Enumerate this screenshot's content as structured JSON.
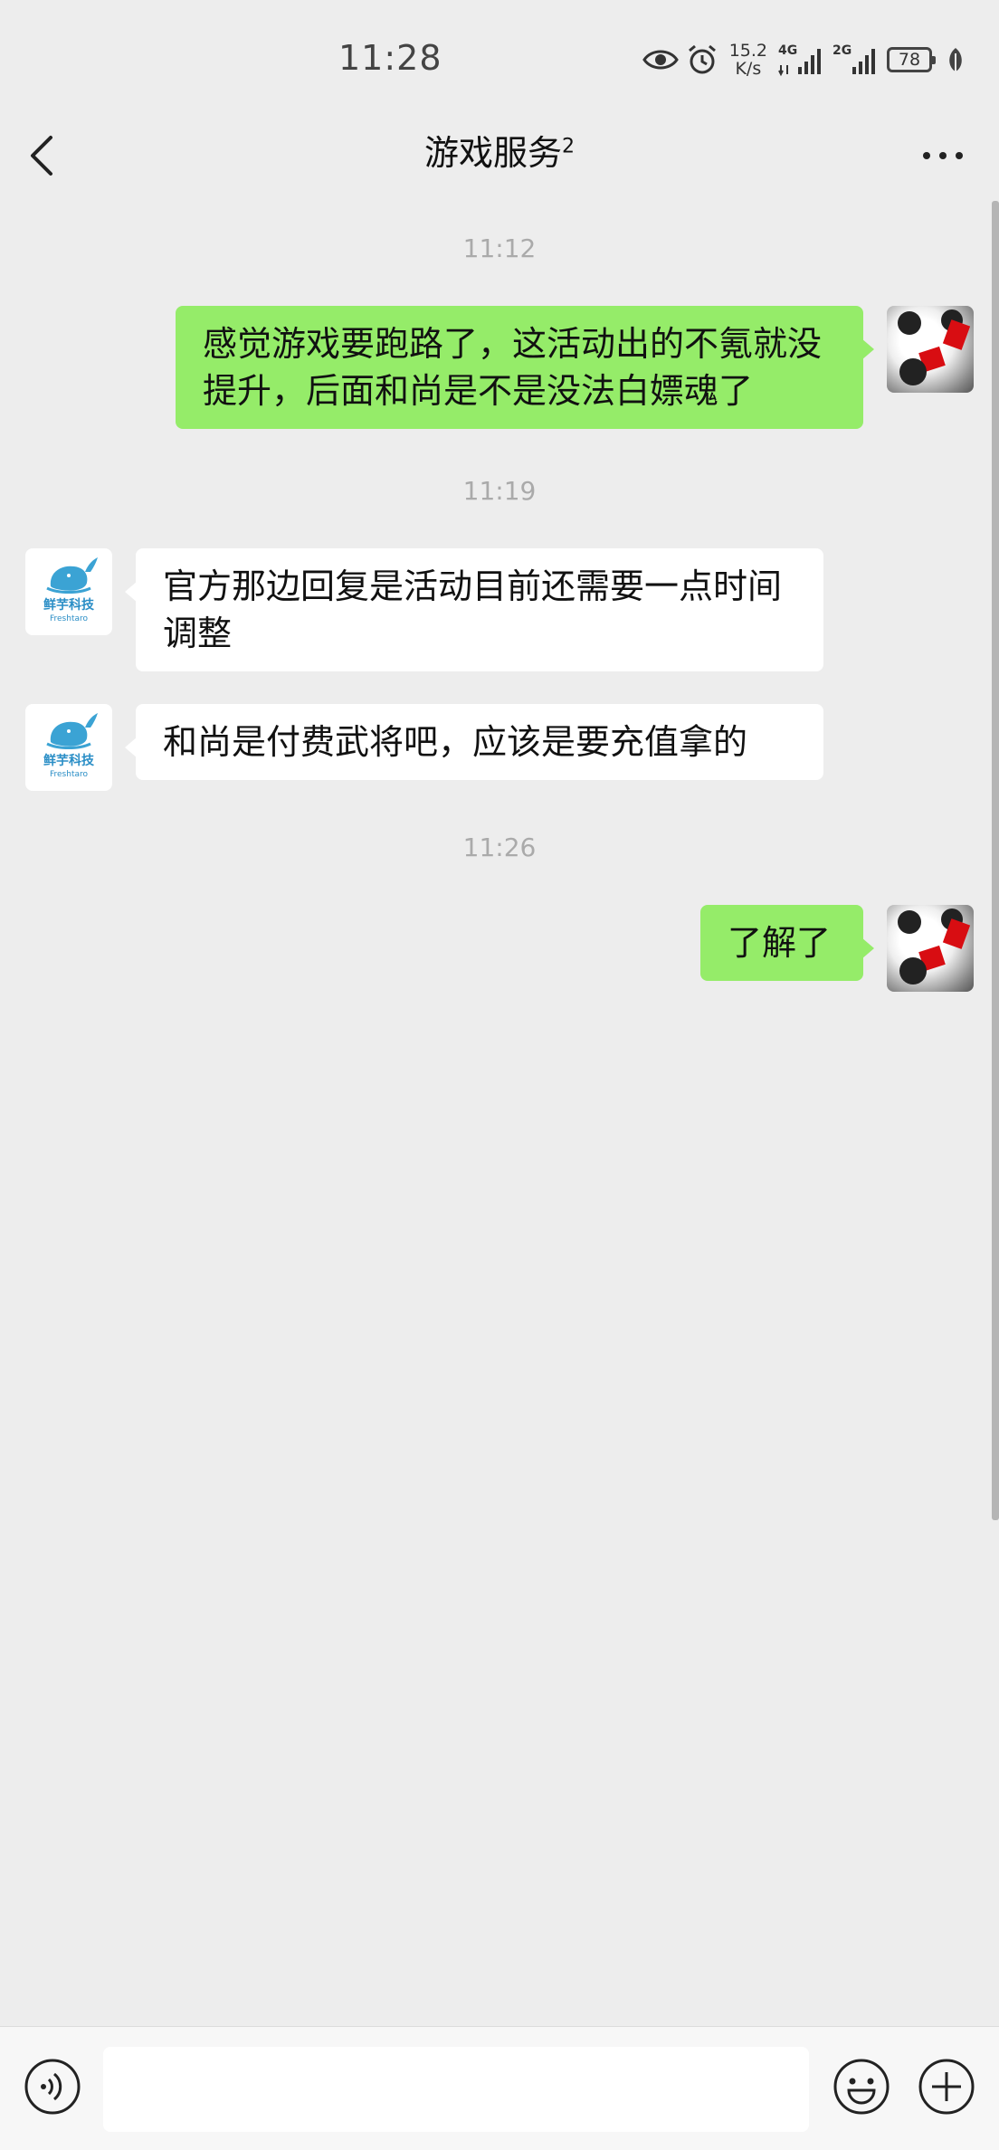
{
  "status_bar": {
    "time": "11:28",
    "net_speed_value": "15.2",
    "net_speed_unit": "K/s",
    "signal1_type": "4G",
    "signal2_type": "2G",
    "battery": "78"
  },
  "header": {
    "title": "游戏服务",
    "title_superscript": "2"
  },
  "messages": {
    "ts1": "11:12",
    "m1": "感觉游戏要跑路了，这活动出的不氪就没提升，后面和尚是不是没法白嫖魂了",
    "ts2": "11:19",
    "m2": "官方那边回复是活动目前还需要一点时间调整",
    "m3": "和尚是付费武将吧，应该是要充值拿的",
    "ts3": "11:26",
    "m4": "了解了"
  },
  "brand_avatar": {
    "name_cn": "鲜芋科技",
    "name_en": "Freshtaro"
  },
  "input_bar": {
    "placeholder": ""
  },
  "colors": {
    "background": "#ededed",
    "self_bubble": "#95ec69",
    "other_bubble": "#ffffff",
    "timestamp": "#aaaaaa"
  }
}
